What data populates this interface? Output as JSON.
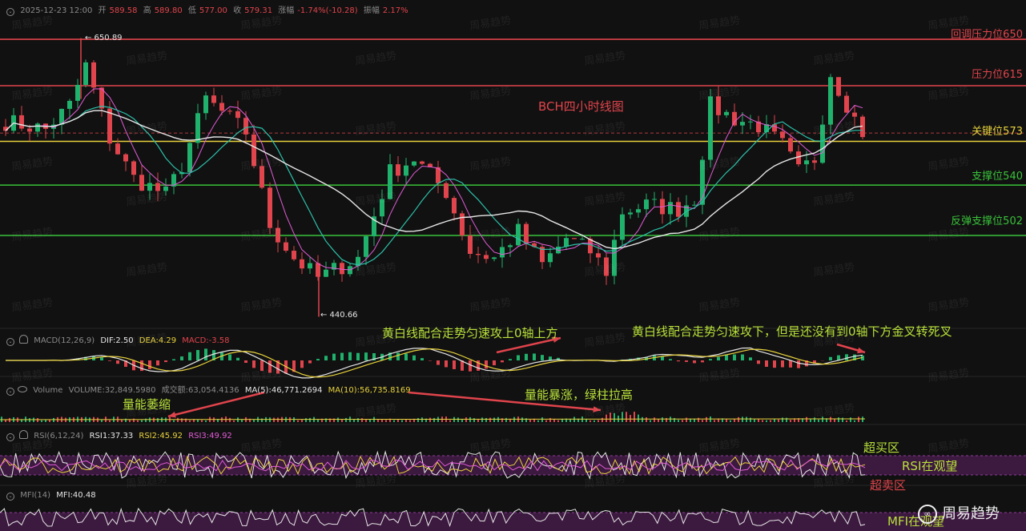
{
  "header": {
    "datetime": "2025-12-23 12:00",
    "open_label": "开",
    "open": "589.58",
    "high_label": "高",
    "high": "589.80",
    "low_label": "低",
    "low": "577.00",
    "close_label": "收",
    "close": "579.31",
    "change_label": "涨幅",
    "change": "-1.74%(-10.28)",
    "amp_label": "振幅",
    "amp": "2.17%"
  },
  "macd": {
    "name": "MACD(12,26,9)",
    "dif": "DIF:2.50",
    "dea": "DEA:4.29",
    "macd": "MACD:-3.58"
  },
  "volume": {
    "name": "Volume",
    "vol": "VOLUME:32,849.5980",
    "turnover": "成交额:63,054.4136",
    "ma5": "MA(5):46,771.2694",
    "ma10": "MA(10):56,735.8169"
  },
  "rsi": {
    "name": "RSI(6,12,24)",
    "rsi1": "RSI1:37.33",
    "rsi2": "RSI2:45.92",
    "rsi3": "RSI3:49.92"
  },
  "mfi": {
    "name": "MFI(14)",
    "mfi": "MFI:40.48"
  },
  "title": "BCH四小时线图",
  "levels": [
    {
      "label": "回调压力位650",
      "value": 650,
      "color": "#e0444c"
    },
    {
      "label": "压力位615",
      "value": 615,
      "color": "#e0444c"
    },
    {
      "label": "关键位573",
      "value": 573,
      "color": "#e8d23c"
    },
    {
      "label": "支撑位540",
      "value": 540,
      "color": "#39c23a"
    },
    {
      "label": "反弹支撑位502",
      "value": 502,
      "color": "#39c23a"
    }
  ],
  "price_marks": {
    "high": "← 650.89",
    "low": "← 440.66"
  },
  "annotations": {
    "macd_left": "黄白线配合走势匀速攻上0轴上方",
    "macd_right": "黄白线配合走势匀速攻下，但是还没有到0轴下方金叉转死叉",
    "vol_left": "量能萎缩",
    "vol_right": "量能暴涨，绿柱拉高",
    "rsi_overbought": "超买区",
    "rsi_watch": "RSI在观望",
    "rsi_oversold": "超卖区",
    "mfi_watch": "MFI在观望"
  },
  "watermark": "周易趋势",
  "brand": {
    "text": "周易趋势",
    "logo": "∞"
  },
  "chart_data": {
    "type": "candlestick",
    "title": "BCH四小时线图",
    "ylim": [
      440.66,
      650.89
    ],
    "price_path": [
      {
        "t": 0,
        "p": 588
      },
      {
        "t": 5,
        "p": 582
      },
      {
        "t": 8,
        "p": 600
      },
      {
        "t": 10,
        "p": 630
      },
      {
        "t": 13,
        "p": 575
      },
      {
        "t": 16,
        "p": 545
      },
      {
        "t": 20,
        "p": 533
      },
      {
        "t": 22,
        "p": 555
      },
      {
        "t": 25,
        "p": 605
      },
      {
        "t": 30,
        "p": 580
      },
      {
        "t": 33,
        "p": 510
      },
      {
        "t": 36,
        "p": 485
      },
      {
        "t": 39,
        "p": 470
      },
      {
        "t": 44,
        "p": 485
      },
      {
        "t": 48,
        "p": 550
      },
      {
        "t": 51,
        "p": 560
      },
      {
        "t": 55,
        "p": 535
      },
      {
        "t": 58,
        "p": 490
      },
      {
        "t": 61,
        "p": 485
      },
      {
        "t": 64,
        "p": 505
      },
      {
        "t": 67,
        "p": 480
      },
      {
        "t": 70,
        "p": 500
      },
      {
        "t": 73,
        "p": 490
      },
      {
        "t": 75,
        "p": 475
      },
      {
        "t": 77,
        "p": 520
      },
      {
        "t": 80,
        "p": 525
      },
      {
        "t": 84,
        "p": 522
      },
      {
        "t": 86,
        "p": 530
      },
      {
        "t": 88,
        "p": 600
      },
      {
        "t": 91,
        "p": 590
      },
      {
        "t": 94,
        "p": 585
      },
      {
        "t": 97,
        "p": 570
      },
      {
        "t": 99,
        "p": 550
      },
      {
        "t": 101,
        "p": 560
      },
      {
        "t": 103,
        "p": 625
      },
      {
        "t": 106,
        "p": 590
      },
      {
        "t": 107,
        "p": 580
      }
    ],
    "extremes": {
      "high": 650.89,
      "low": 440.66
    },
    "levels": [
      650,
      615,
      573,
      540,
      502
    ]
  }
}
